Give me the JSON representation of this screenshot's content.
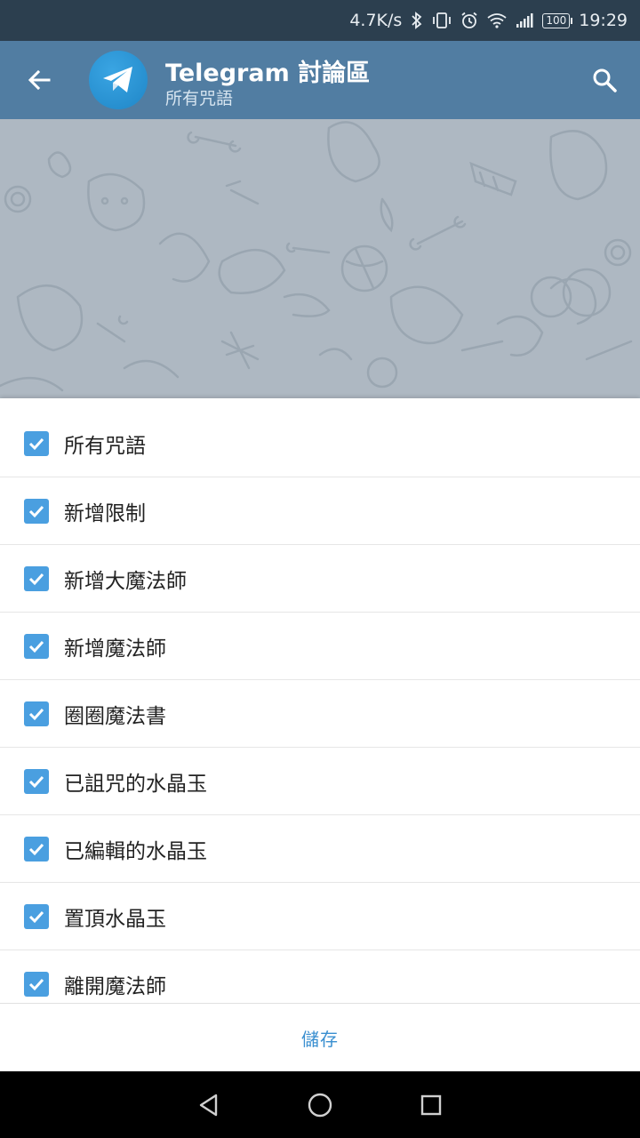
{
  "status_bar": {
    "net_speed": "4.7K/s",
    "battery": "100",
    "time": "19:29",
    "icons": [
      "bluetooth-icon",
      "vibrate-icon",
      "alarm-icon",
      "wifi-icon",
      "signal-icon",
      "battery-icon"
    ]
  },
  "header": {
    "title": "Telegram 討論區",
    "subtitle": "所有咒語",
    "back_icon": "arrow-left-icon",
    "search_icon": "search-icon",
    "avatar_icon": "telegram-plane-icon"
  },
  "permissions": [
    {
      "label": "所有咒語",
      "checked": true
    },
    {
      "label": "新增限制",
      "checked": true
    },
    {
      "label": "新增大魔法師",
      "checked": true
    },
    {
      "label": "新增魔法師",
      "checked": true
    },
    {
      "label": "圈圈魔法書",
      "checked": true
    },
    {
      "label": "已詛咒的水晶玉",
      "checked": true
    },
    {
      "label": "已編輯的水晶玉",
      "checked": true
    },
    {
      "label": "置頂水晶玉",
      "checked": true
    },
    {
      "label": "離開魔法師",
      "checked": true
    }
  ],
  "save_label": "儲存",
  "colors": {
    "status_bar": "#2c3f4f",
    "app_bar": "#517da2",
    "checkbox": "#4a9fe0",
    "save_text": "#3a8fd0"
  }
}
